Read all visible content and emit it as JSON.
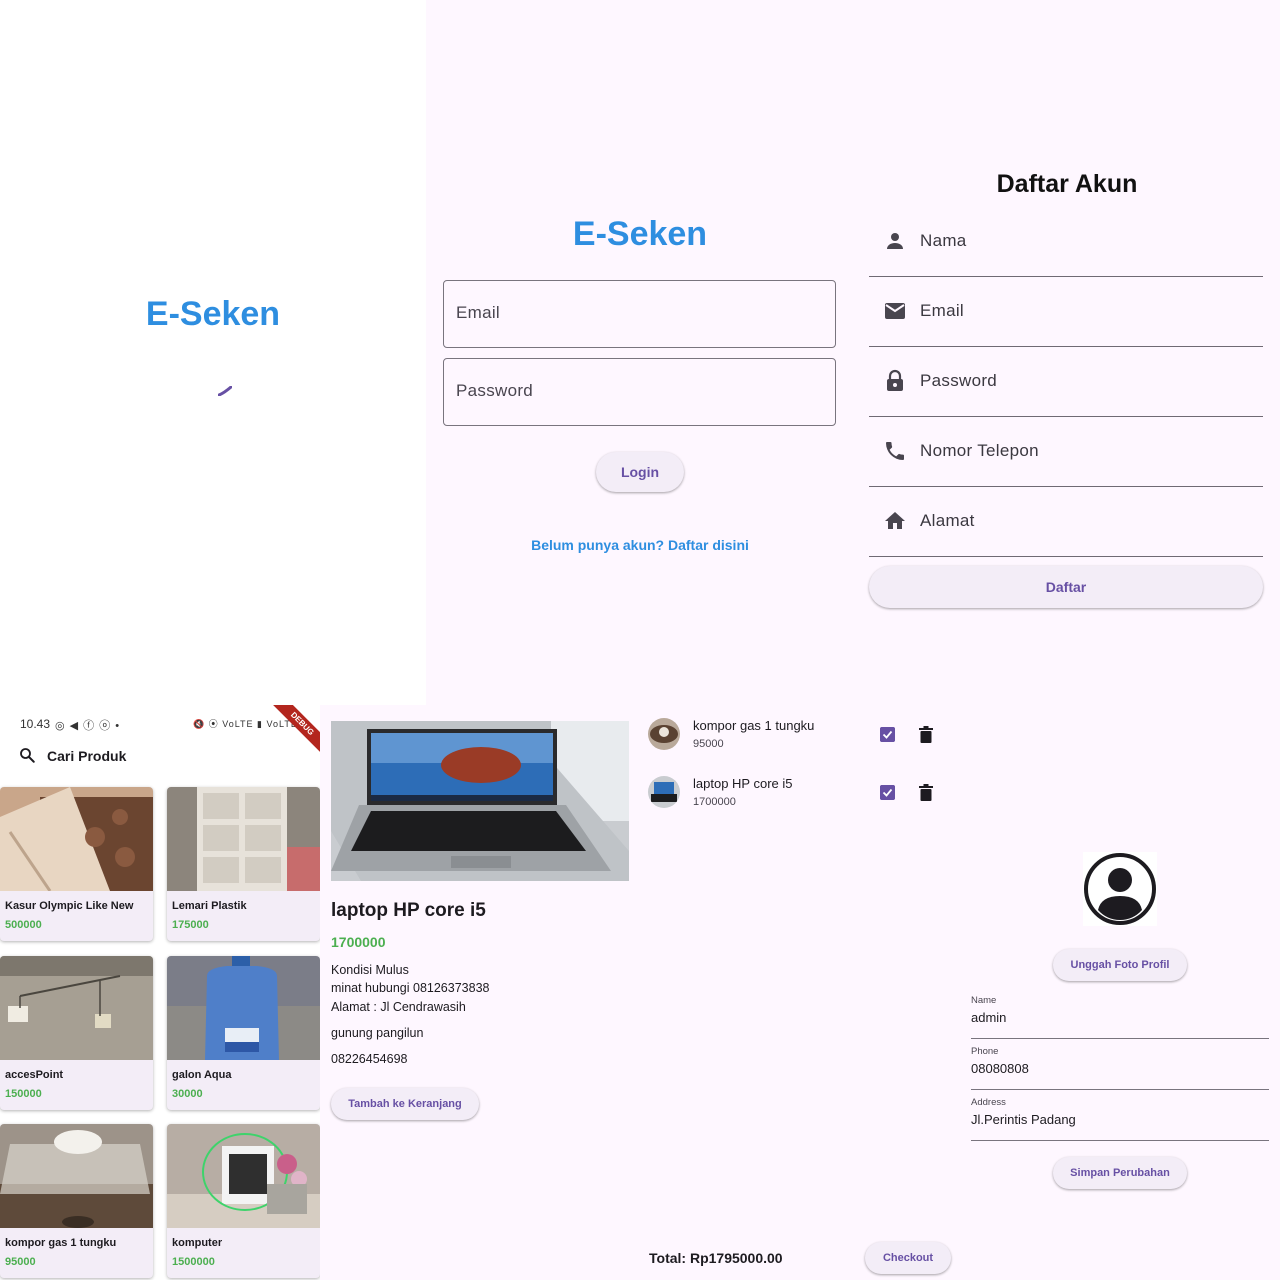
{
  "splash": {
    "brand": "E-Seken"
  },
  "login": {
    "brand": "E-Seken",
    "email_label": "Email",
    "password_label": "Password",
    "login_button": "Login",
    "register_link": "Belum punya akun? Daftar disini"
  },
  "register": {
    "title": "Daftar Akun",
    "fields": [
      {
        "label": "Nama",
        "icon": "person-icon"
      },
      {
        "label": "Email",
        "icon": "mail-icon"
      },
      {
        "label": "Password",
        "icon": "lock-icon"
      },
      {
        "label": "Nomor Telepon",
        "icon": "phone-icon"
      },
      {
        "label": "Alamat",
        "icon": "home-icon"
      }
    ],
    "submit_button": "Daftar"
  },
  "home": {
    "status_time": "10.43",
    "status_icons_left": "◎ ◀ ⓕ ⓞ •",
    "status_icons_right": "🔇 ⦿ VoLTE ▮ VoLTE ▮",
    "debug_banner": "DEBUG",
    "search_label": "Cari Produk",
    "products": [
      {
        "name": "Kasur Olympic Like New",
        "price": "500000"
      },
      {
        "name": "Lemari Plastik",
        "price": "175000"
      },
      {
        "name": "accesPoint",
        "price": "150000"
      },
      {
        "name": "galon Aqua",
        "price": "30000"
      },
      {
        "name": "kompor gas 1 tungku",
        "price": "95000"
      },
      {
        "name": "komputer",
        "price": "1500000"
      }
    ]
  },
  "detail": {
    "title": "laptop HP core i5",
    "price": "1700000",
    "desc_line1": "Kondisi Mulus",
    "desc_line2": "minat hubungi 08126373838",
    "desc_line3": "Alamat : Jl Cendrawasih",
    "desc_line4": "gunung pangilun",
    "phone": "08226454698",
    "add_to_cart": "Tambah ke Keranjang"
  },
  "cart": {
    "items": [
      {
        "name": "kompor gas 1 tungku",
        "price": "95000",
        "checked": true
      },
      {
        "name": "laptop HP core i5",
        "price": "1700000",
        "checked": true
      }
    ],
    "total": "Total: Rp1795000.00",
    "checkout": "Checkout"
  },
  "profile": {
    "upload_button": "Unggah Foto Profil",
    "name_label": "Name",
    "name_value": "admin",
    "phone_label": "Phone",
    "phone_value": "08080808",
    "address_label": "Address",
    "address_value": "Jl.Perintis Padang",
    "save_button": "Simpan Perubahan"
  },
  "colors": {
    "brand": "#2e8ee0",
    "primary": "#6750a4",
    "price_green": "#4caf50",
    "surface": "#fef7ff"
  }
}
